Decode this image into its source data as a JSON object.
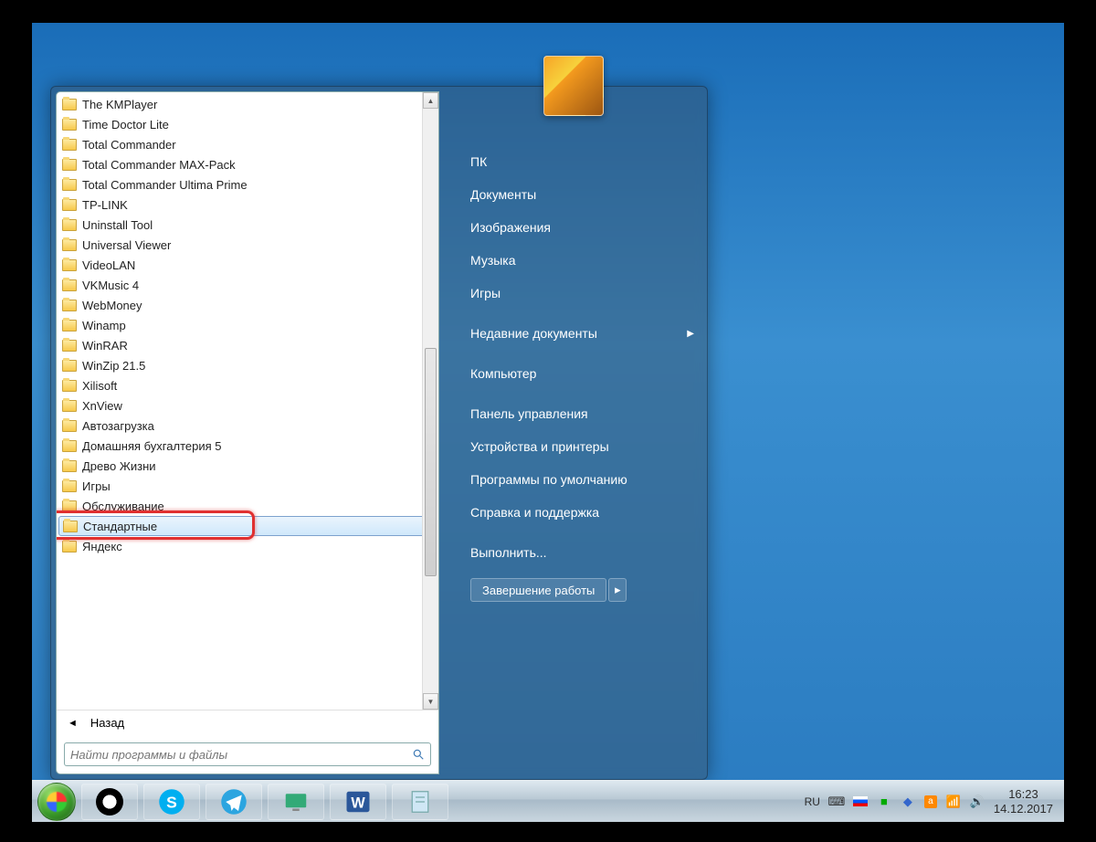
{
  "programs": [
    "The KMPlayer",
    "Time Doctor Lite",
    "Total Commander",
    "Total Commander MAX-Pack",
    "Total Commander Ultima Prime",
    "TP-LINK",
    "Uninstall Tool",
    "Universal Viewer",
    "VideoLAN",
    "VKMusic 4",
    "WebMoney",
    "Winamp",
    "WinRAR",
    "WinZip 21.5",
    "Xilisoft",
    "XnView",
    "Автозагрузка",
    "Домашняя бухгалтерия 5",
    "Древо Жизни",
    "Игры",
    "Обслуживание",
    "Стандартные",
    "Яндекс"
  ],
  "selected_program_index": 21,
  "back_label": "Назад",
  "search_placeholder": "Найти программы и файлы",
  "right_items": [
    {
      "label": "ПК",
      "arrow": false
    },
    {
      "label": "Документы",
      "arrow": false
    },
    {
      "label": "Изображения",
      "arrow": false
    },
    {
      "label": "Музыка",
      "arrow": false
    },
    {
      "label": "Игры",
      "arrow": false
    },
    {
      "label": "Недавние документы",
      "arrow": true
    },
    {
      "label": "Компьютер",
      "arrow": false
    },
    {
      "label": "Панель управления",
      "arrow": false
    },
    {
      "label": "Устройства и принтеры",
      "arrow": false
    },
    {
      "label": "Программы по умолчанию",
      "arrow": false
    },
    {
      "label": "Справка и поддержка",
      "arrow": false
    },
    {
      "label": "Выполнить...",
      "arrow": false
    }
  ],
  "right_separators_after": [
    4,
    5,
    6,
    10
  ],
  "shutdown_label": "Завершение работы",
  "tray": {
    "lang": "RU",
    "time": "16:23",
    "date": "14.12.2017"
  },
  "colors": {
    "highlight": "#e03030",
    "win_blue": "#2a7bc0"
  }
}
